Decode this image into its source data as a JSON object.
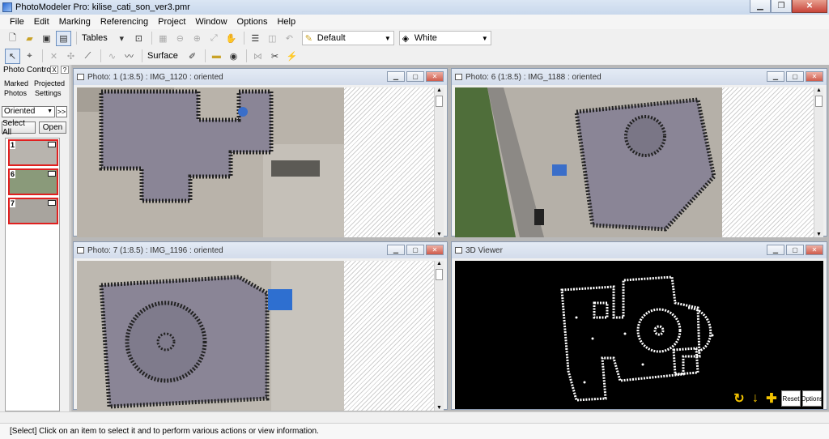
{
  "window": {
    "title": "PhotoModeler Pro: kilise_cati_son_ver3.pmr"
  },
  "menu": [
    "File",
    "Edit",
    "Marking",
    "Referencing",
    "Project",
    "Window",
    "Options",
    "Help"
  ],
  "toolbar": {
    "tables_label": "Tables",
    "template_combo": "Default",
    "color_combo": "White",
    "surface_label": "Surface"
  },
  "photo_control": {
    "title": "Photo Control",
    "close_btn": "X",
    "help_btn": "?",
    "tab_marked": "Marked",
    "tab_photos": "Photos",
    "tab_projected": "Projected",
    "tab_settings": "Settings",
    "filter_value": "Oriented",
    "expand_label": ">>",
    "select_all": "Select All",
    "open": "Open",
    "thumbnails": [
      {
        "num": "1"
      },
      {
        "num": "6"
      },
      {
        "num": "7"
      }
    ]
  },
  "windows": {
    "photo1": {
      "caption": "Photo: 1 (1:8.5) : IMG_1120 : oriented"
    },
    "photo6": {
      "caption": "Photo: 6 (1:8.5) : IMG_1188 : oriented"
    },
    "photo7": {
      "caption": "Photo: 7 (1:8.5) : IMG_1196 : oriented"
    },
    "viewer": {
      "caption": "3D Viewer",
      "reset": "Reset",
      "options": "Options"
    }
  },
  "status": {
    "text": "[Select] Click on an item to select it and to perform various actions or view information."
  },
  "colors": {
    "marker_red": "#e02020",
    "viewer_bg": "#000000",
    "accent_yellow": "#f2c200"
  }
}
